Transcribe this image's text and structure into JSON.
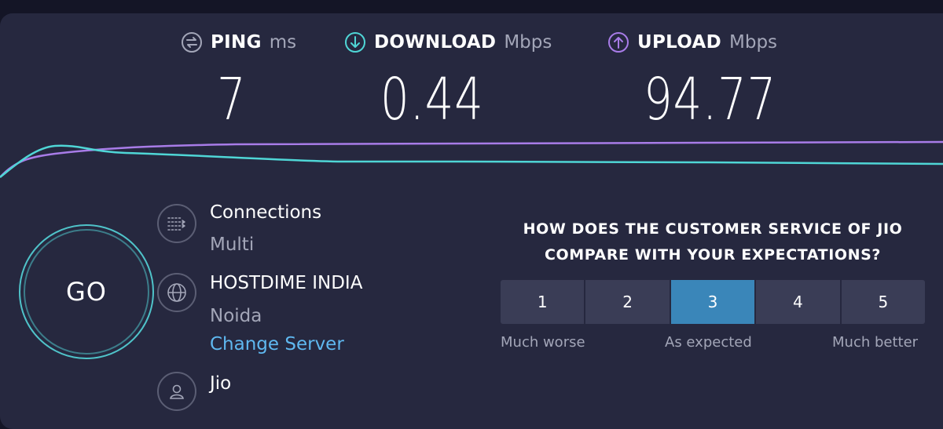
{
  "colors": {
    "background": "#141526",
    "panel": "#26283f",
    "download_accent": "#4fd6d6",
    "upload_accent": "#a87ce8",
    "go_ring": "#4fc3c9",
    "link": "#5fb8f0",
    "rating_selected": "#3a86b9",
    "rating_default": "#3a3d56",
    "muted_text": "#a3a6b8"
  },
  "metrics": {
    "ping": {
      "icon": "ping-icon",
      "label": "PING",
      "unit": "ms",
      "value": "7"
    },
    "download": {
      "icon": "download-arrow-icon",
      "label": "DOWNLOAD",
      "unit": "Mbps",
      "value": "0.44"
    },
    "upload": {
      "icon": "upload-arrow-icon",
      "label": "UPLOAD",
      "unit": "Mbps",
      "value": "94.77"
    }
  },
  "go_button": {
    "label": "GO"
  },
  "connections": {
    "icon": "connections-icon",
    "title": "Connections",
    "value": "Multi"
  },
  "server": {
    "icon": "globe-icon",
    "name": "HOSTDIME INDIA",
    "location": "Noida",
    "change_label": "Change Server"
  },
  "provider": {
    "icon": "user-icon",
    "name": "Jio"
  },
  "survey": {
    "question_line1": "HOW DOES THE CUSTOMER SERVICE OF JIO",
    "question_line2": "COMPARE WITH YOUR EXPECTATIONS?",
    "options": [
      "1",
      "2",
      "3",
      "4",
      "5"
    ],
    "selected": "3",
    "scale_low": "Much worse",
    "scale_mid": "As expected",
    "scale_high": "Much better"
  }
}
